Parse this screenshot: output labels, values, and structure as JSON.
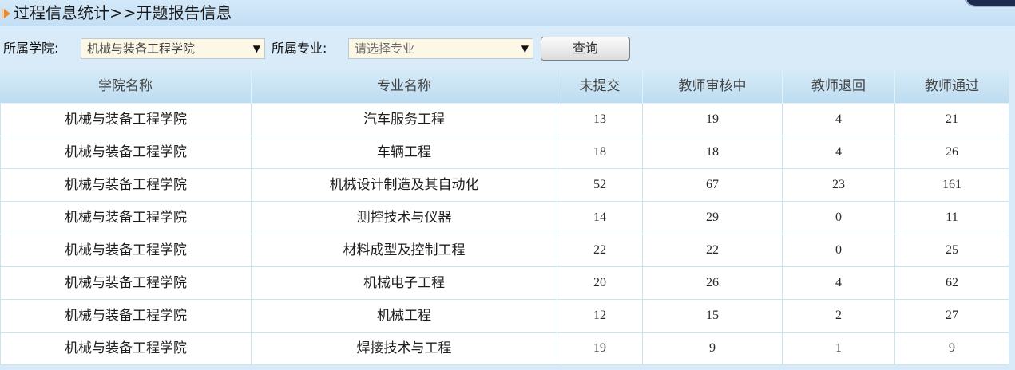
{
  "header": {
    "title": "过程信息统计>>开题报告信息",
    "icon": "orange-arrow-icon"
  },
  "filters": {
    "college_label": "所属学院:",
    "college_selected": "机械与装备工程学院",
    "major_label": "所属专业:",
    "major_placeholder": "请选择专业",
    "query_button": "查询"
  },
  "table": {
    "columns": {
      "college": "学院名称",
      "major": "专业名称",
      "not_submitted": "未提交",
      "reviewing": "教师审核中",
      "returned": "教师退回",
      "approved": "教师通过"
    },
    "rows": [
      {
        "college": "机械与装备工程学院",
        "major": "汽车服务工程",
        "not_submitted": 13,
        "reviewing": 19,
        "returned": 4,
        "approved": 21
      },
      {
        "college": "机械与装备工程学院",
        "major": "车辆工程",
        "not_submitted": 18,
        "reviewing": 18,
        "returned": 4,
        "approved": 26
      },
      {
        "college": "机械与装备工程学院",
        "major": "机械设计制造及其自动化",
        "not_submitted": 52,
        "reviewing": 67,
        "returned": 23,
        "approved": 161
      },
      {
        "college": "机械与装备工程学院",
        "major": "测控技术与仪器",
        "not_submitted": 14,
        "reviewing": 29,
        "returned": 0,
        "approved": 11
      },
      {
        "college": "机械与装备工程学院",
        "major": "材料成型及控制工程",
        "not_submitted": 22,
        "reviewing": 22,
        "returned": 0,
        "approved": 25
      },
      {
        "college": "机械与装备工程学院",
        "major": "机械电子工程",
        "not_submitted": 20,
        "reviewing": 26,
        "returned": 4,
        "approved": 62
      },
      {
        "college": "机械与装备工程学院",
        "major": "机械工程",
        "not_submitted": 12,
        "reviewing": 15,
        "returned": 2,
        "approved": 27
      },
      {
        "college": "机械与装备工程学院",
        "major": "焊接技术与工程",
        "not_submitted": 19,
        "reviewing": 9,
        "returned": 1,
        "approved": 9
      }
    ]
  },
  "colors": {
    "page_background": "#d9ebf8",
    "title_bar": "#c4def4",
    "table_header": "#bddcf0",
    "grid_line": "#c9e6ee",
    "select_background": "#fdf7e6",
    "icon_accent": "#f08a24"
  }
}
